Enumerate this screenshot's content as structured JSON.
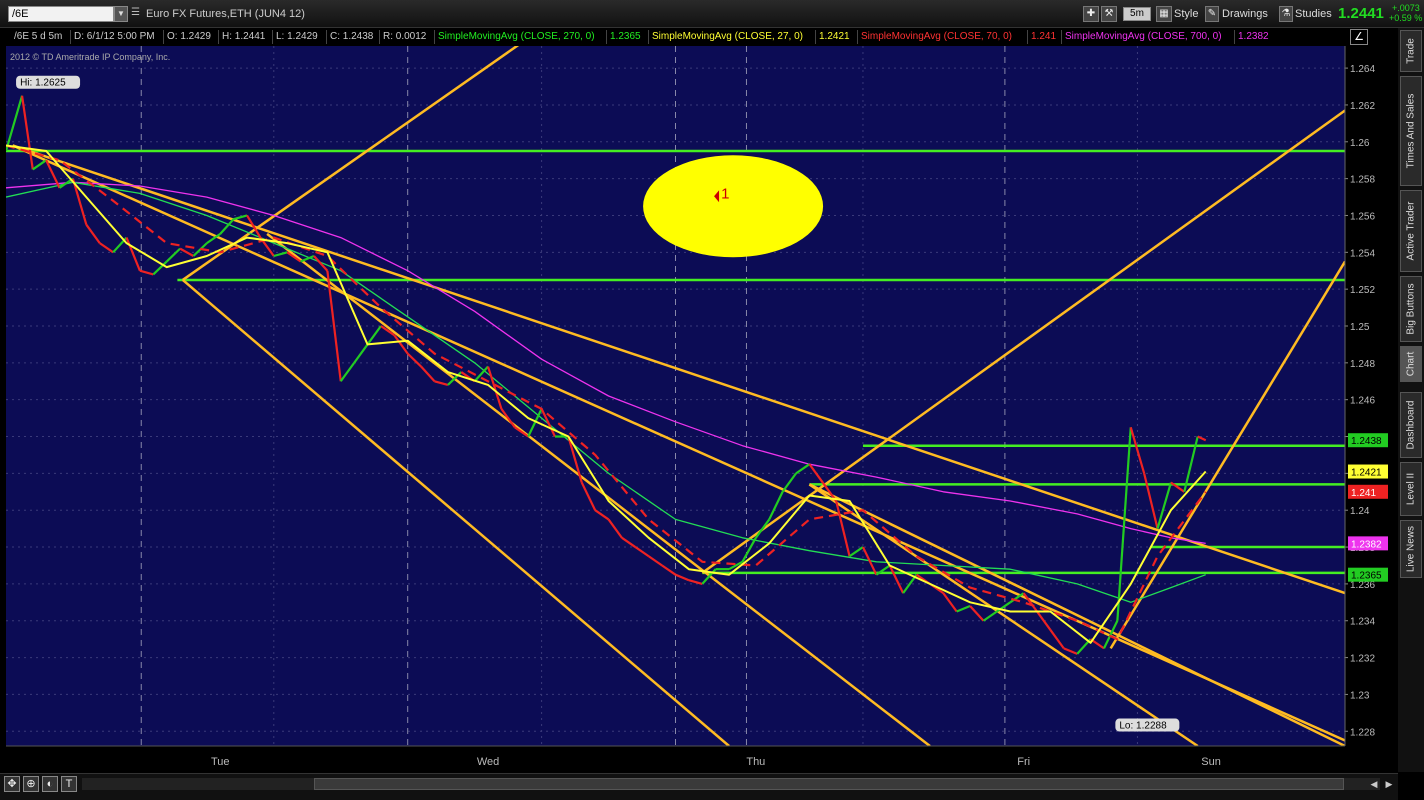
{
  "header": {
    "symbol": "/6E",
    "instrument_title": "Euro FX Futures,ETH (JUN4 12)",
    "timeframe_button": "5m",
    "style_label": "Style",
    "drawings_label": "Drawings",
    "studies_label": "Studies",
    "last_price": "1.2441",
    "change_abs": "+.0073",
    "change_pct": "+0.59 %"
  },
  "status_line": {
    "chart_settings": "/6E 5 d 5m",
    "date": "D: 6/1/12 5:00 PM",
    "open": "O: 1.2429",
    "high": "H: 1.2441",
    "low": "L: 1.2429",
    "close": "C: 1.2438",
    "range": "R: 0.0012",
    "sma270_label": "SimpleMovingAvg (CLOSE, 270, 0)",
    "sma270_value": "1.2365",
    "sma27_label": "SimpleMovingAvg (CLOSE, 27, 0)",
    "sma27_value": "1.2421",
    "sma70_label": "SimpleMovingAvg (CLOSE, 70, 0)",
    "sma70_value": "1.241",
    "sma700_label": "SimpleMovingAvg (CLOSE, 700, 0)",
    "sma700_value": "1.2382",
    "colors": {
      "sma270": "#22ee22",
      "sma27": "#ffff33",
      "sma70": "#ff3333",
      "sma700": "#ee33ee"
    }
  },
  "side_tabs": [
    "Trade",
    "Times And Sales",
    "Active Trader",
    "Big Buttons",
    "Chart",
    "Dashboard",
    "Level II",
    "Live News"
  ],
  "chart_data": {
    "type": "line",
    "copyright": "2012 © TD Ameritrade IP Company, Inc.",
    "ylim": [
      1.2272,
      1.2652
    ],
    "y_ticks": [
      1.228,
      1.23,
      1.232,
      1.234,
      1.236,
      1.238,
      1.24,
      1.242,
      1.244,
      1.246,
      1.248,
      1.25,
      1.252,
      1.254,
      1.256,
      1.258,
      1.26,
      1.262,
      1.264
    ],
    "y_tick_labels": [
      "1.228",
      "1.23",
      "1.232",
      "1.234",
      "1.236",
      "1.238",
      "1.24",
      "1.242",
      "1.244",
      "1.246",
      "1.248",
      "1.25",
      "1.252",
      "1.254",
      "1.256",
      "1.258",
      "1.26",
      "1.262",
      "1.264"
    ],
    "xlim": [
      0,
      100
    ],
    "x_day_labels": [
      {
        "label": "Tue",
        "x": 16
      },
      {
        "label": "Wed",
        "x": 36
      },
      {
        "label": "Thu",
        "x": 56
      },
      {
        "label": "Fri",
        "x": 76
      },
      {
        "label": "Sun",
        "x": 90
      }
    ],
    "x_divider_positions": [
      10.1,
      30,
      50,
      55.3,
      74.6
    ],
    "x_minor_positions": [
      20,
      40,
      64,
      84.5
    ],
    "high_label": "Hi: 1.2625",
    "high_point": {
      "x": 1.2,
      "y": 1.2625
    },
    "low_label": "Lo: 1.2288",
    "low_point": {
      "x": 83,
      "y": 1.2288
    },
    "price_series": {
      "name": "/6E",
      "x": [
        0,
        1.2,
        2,
        3,
        4,
        5,
        6,
        7,
        8,
        9,
        10,
        11,
        12,
        13,
        14,
        15,
        16,
        17,
        18,
        19,
        20,
        21,
        22,
        23,
        24,
        25,
        26,
        27,
        28,
        29,
        30,
        31,
        32,
        33,
        34,
        35,
        36,
        37,
        38,
        39,
        40,
        41,
        42,
        43,
        44,
        45,
        46,
        47,
        48,
        49,
        50,
        51,
        52,
        53,
        54,
        55,
        56,
        57,
        58,
        59,
        60,
        61,
        62,
        63,
        64,
        65,
        66,
        67,
        68,
        69,
        70,
        71,
        72,
        73,
        74,
        75,
        76,
        77,
        78,
        79,
        80,
        81,
        82,
        83,
        84,
        85,
        86,
        87,
        88,
        89,
        89.6
      ],
      "values": [
        1.2595,
        1.2625,
        1.2585,
        1.259,
        1.2575,
        1.258,
        1.2555,
        1.2545,
        1.254,
        1.2548,
        1.253,
        1.2528,
        1.2535,
        1.2542,
        1.2538,
        1.2545,
        1.255,
        1.2558,
        1.256,
        1.2548,
        1.2538,
        1.254,
        1.2535,
        1.2538,
        1.253,
        1.247,
        1.248,
        1.249,
        1.25,
        1.2495,
        1.2485,
        1.2478,
        1.247,
        1.2468,
        1.2475,
        1.247,
        1.2478,
        1.2455,
        1.2445,
        1.244,
        1.2455,
        1.244,
        1.244,
        1.2415,
        1.24,
        1.2395,
        1.2385,
        1.238,
        1.2375,
        1.237,
        1.2365,
        1.2362,
        1.236,
        1.2368,
        1.2368,
        1.2372,
        1.2385,
        1.2395,
        1.241,
        1.242,
        1.2425,
        1.2415,
        1.2405,
        1.2375,
        1.238,
        1.2365,
        1.237,
        1.2355,
        1.2365,
        1.236,
        1.2355,
        1.2345,
        1.2348,
        1.234,
        1.2345,
        1.235,
        1.2355,
        1.2345,
        1.2335,
        1.2325,
        1.2322,
        1.233,
        1.2325,
        1.234,
        1.2445,
        1.242,
        1.239,
        1.2415,
        1.241,
        1.244,
        1.2438
      ]
    },
    "sma27": {
      "name": "SimpleMovingAvg (CLOSE, 27, 0)",
      "x": [
        0,
        3,
        6,
        9,
        12,
        15,
        18,
        21,
        24,
        27,
        30,
        33,
        36,
        39,
        42,
        45,
        48,
        51,
        54,
        57,
        60,
        63,
        66,
        69,
        72,
        75,
        78,
        81,
        84,
        87,
        89.6
      ],
      "values": [
        1.2598,
        1.2595,
        1.257,
        1.2545,
        1.2532,
        1.2538,
        1.2548,
        1.2545,
        1.254,
        1.249,
        1.2492,
        1.2475,
        1.2468,
        1.245,
        1.244,
        1.2405,
        1.2385,
        1.2368,
        1.2365,
        1.2382,
        1.2408,
        1.2405,
        1.237,
        1.236,
        1.235,
        1.2345,
        1.2345,
        1.2328,
        1.236,
        1.24,
        1.2421
      ]
    },
    "sma70": {
      "name": "SimpleMovingAvg (CLOSE, 70, 0)",
      "x": [
        0,
        4,
        8,
        12,
        16,
        20,
        24,
        28,
        32,
        36,
        40,
        44,
        48,
        52,
        56,
        60,
        64,
        68,
        72,
        76,
        80,
        83,
        86,
        89.6
      ],
      "values": [
        1.2598,
        1.259,
        1.2568,
        1.2545,
        1.254,
        1.2548,
        1.2538,
        1.251,
        1.2485,
        1.247,
        1.2455,
        1.243,
        1.2395,
        1.2372,
        1.237,
        1.2395,
        1.24,
        1.2375,
        1.2358,
        1.235,
        1.234,
        1.233,
        1.2375,
        1.241
      ]
    },
    "sma270": {
      "name": "SimpleMovingAvg (CLOSE, 270, 0)",
      "x": [
        0,
        5,
        10,
        15,
        20,
        25,
        30,
        35,
        40,
        45,
        50,
        55,
        60,
        65,
        70,
        75,
        80,
        84,
        87,
        89.6
      ],
      "values": [
        1.257,
        1.2578,
        1.2572,
        1.256,
        1.2545,
        1.253,
        1.2505,
        1.248,
        1.245,
        1.242,
        1.2395,
        1.2385,
        1.2378,
        1.2372,
        1.237,
        1.2368,
        1.236,
        1.235,
        1.2358,
        1.2365
      ]
    },
    "sma700": {
      "name": "SimpleMovingAvg (CLOSE, 700, 0)",
      "x": [
        0,
        5,
        10,
        15,
        20,
        25,
        30,
        35,
        40,
        45,
        50,
        55,
        60,
        65,
        70,
        75,
        80,
        84,
        87,
        89.6
      ],
      "values": [
        1.2575,
        1.2578,
        1.2576,
        1.257,
        1.256,
        1.2548,
        1.253,
        1.2508,
        1.2482,
        1.2462,
        1.2448,
        1.2435,
        1.2425,
        1.2418,
        1.241,
        1.2405,
        1.2398,
        1.239,
        1.2385,
        1.2382
      ]
    },
    "horizontal_lines": [
      {
        "y": 1.2595,
        "x1": 0,
        "x2": 100
      },
      {
        "y": 1.2525,
        "x1": 12.8,
        "x2": 100
      },
      {
        "y": 1.2435,
        "x1": 64,
        "x2": 100
      },
      {
        "y": 1.2414,
        "x1": 60,
        "x2": 100
      },
      {
        "y": 1.238,
        "x1": 85.5,
        "x2": 100
      },
      {
        "y": 1.2366,
        "x1": 52,
        "x2": 100
      }
    ],
    "trend_lines": [
      {
        "x1": 0.5,
        "y1": 1.2598,
        "x2": 100,
        "y2": 1.2275
      },
      {
        "x1": 0.5,
        "y1": 1.2598,
        "x2": 100,
        "y2": 1.2355
      },
      {
        "x1": 13.2,
        "y1": 1.2525,
        "x2": 47,
        "y2": 1.2697
      },
      {
        "x1": 13.2,
        "y1": 1.2525,
        "x2": 54,
        "y2": 1.2272
      },
      {
        "x1": 19.5,
        "y1": 1.255,
        "x2": 69,
        "y2": 1.2272
      },
      {
        "x1": 52,
        "y1": 1.2366,
        "x2": 100,
        "y2": 1.2617
      },
      {
        "x1": 60,
        "y1": 1.2414,
        "x2": 89,
        "y2": 1.2272
      },
      {
        "x1": 60,
        "y1": 1.2414,
        "x2": 100,
        "y2": 1.2272
      },
      {
        "x1": 82.5,
        "y1": 1.2325,
        "x2": 100,
        "y2": 1.2535
      }
    ],
    "annotation": {
      "label": "1",
      "x": 54.3,
      "y": 1.2565
    },
    "price_badges": [
      {
        "label": "1.2438",
        "y": 1.2438,
        "bg": "#22cc22",
        "fg": "#000000"
      },
      {
        "label": "1.2421",
        "y": 1.2421,
        "bg": "#ffff33",
        "fg": "#000000"
      },
      {
        "label": "1.241",
        "y": 1.241,
        "bg": "#ee2222",
        "fg": "#ffffff"
      },
      {
        "label": "1.2382",
        "y": 1.2382,
        "bg": "#ee33ee",
        "fg": "#ffffff"
      },
      {
        "label": "1.2365",
        "y": 1.2365,
        "bg": "#22cc22",
        "fg": "#000000"
      }
    ],
    "colors": {
      "background": "#0c0c55",
      "grid": "#3a3a7a",
      "price_up": "#22cc22",
      "price_down": "#ee2222",
      "sma27": "#ffff33",
      "sma70": "#ee2222",
      "sma270": "#22dd55",
      "sma700": "#ee33ee",
      "support_resistance": "#44ee22",
      "trend": "#ffbb22",
      "annotation_fill": "#ffff00",
      "annotation_text": "#cc0000",
      "axis_text": "#bbbbbb"
    },
    "grid": true
  }
}
